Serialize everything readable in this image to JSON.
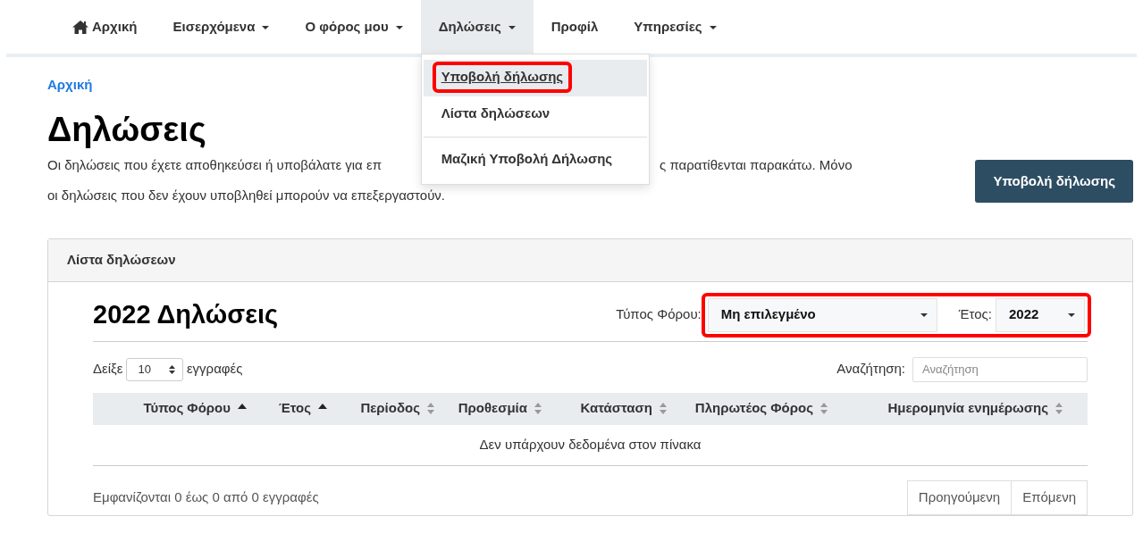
{
  "nav": {
    "items": [
      {
        "label": "Αρχική",
        "kind": "home",
        "dropdown": false,
        "open": false
      },
      {
        "label": "Εισερχόμενα",
        "kind": "link",
        "dropdown": true,
        "open": false
      },
      {
        "label": "Ο φόρος μου",
        "kind": "link",
        "dropdown": true,
        "open": false
      },
      {
        "label": "Δηλώσεις",
        "kind": "link",
        "dropdown": true,
        "open": true
      },
      {
        "label": "Προφίλ",
        "kind": "link",
        "dropdown": false,
        "open": false
      },
      {
        "label": "Υπηρεσίες",
        "kind": "link",
        "dropdown": true,
        "open": false
      }
    ]
  },
  "dropdown_menu": {
    "items": [
      {
        "label": "Υποβολή δήλωσης",
        "selected": true,
        "highlighted": true,
        "divider_before": false
      },
      {
        "label": "Λίστα δηλώσεων",
        "selected": false,
        "highlighted": false,
        "divider_before": false
      },
      {
        "label": "Μαζική Υποβολή Δήλωσης",
        "selected": false,
        "highlighted": false,
        "divider_before": true
      }
    ]
  },
  "breadcrumb": "Αρχική",
  "title": "Δηλώσεις",
  "description": {
    "line_1_start": "Οι δηλώσεις που έχετε αποθηκεύσει ή υποβάλατε για επ",
    "line_1_end": "ς παρατίθενται παρακάτω. Μόνο",
    "line_2": "οι δηλώσεις που δεν έχουν υποβληθεί μπορούν να επεξεργαστούν."
  },
  "submit_button": "Υποβολή δήλωσης",
  "card": {
    "header": "Λίστα δηλώσεων",
    "heading": "2022 Δηλώσεις",
    "filters": {
      "highlighted": true,
      "tax_type_label": "Τύπος Φόρου:",
      "tax_type_value": "Μη επιλεγμένο",
      "year_label": "Έτος:",
      "year_value": "2022"
    },
    "length": {
      "before": "Δείξε",
      "value": "10",
      "after": "εγγραφές"
    },
    "search": {
      "label": "Αναζήτηση:",
      "placeholder": "Αναζήτηση"
    },
    "table": {
      "columns": [
        {
          "label": "Τύπος Φόρου",
          "sorted": true
        },
        {
          "label": "Έτος",
          "sorted": true
        },
        {
          "label": "Περίοδος",
          "sorted": false
        },
        {
          "label": "Προθεσμία",
          "sorted": false
        },
        {
          "label": "Κατάσταση",
          "sorted": false
        },
        {
          "label": "Πληρωτέος Φόρος",
          "sorted": false
        },
        {
          "label": "Ημερομηνία ενημέρωσης",
          "sorted": false
        }
      ],
      "empty_message": "Δεν υπάρχουν δεδομένα στον πίνακα"
    },
    "info": "Εμφανίζονται 0 έως 0 από 0 εγγραφές",
    "pagination": [
      {
        "label": "Προηγούμενη",
        "disabled": true
      },
      {
        "label": "Επόμενη",
        "disabled": true
      }
    ]
  }
}
